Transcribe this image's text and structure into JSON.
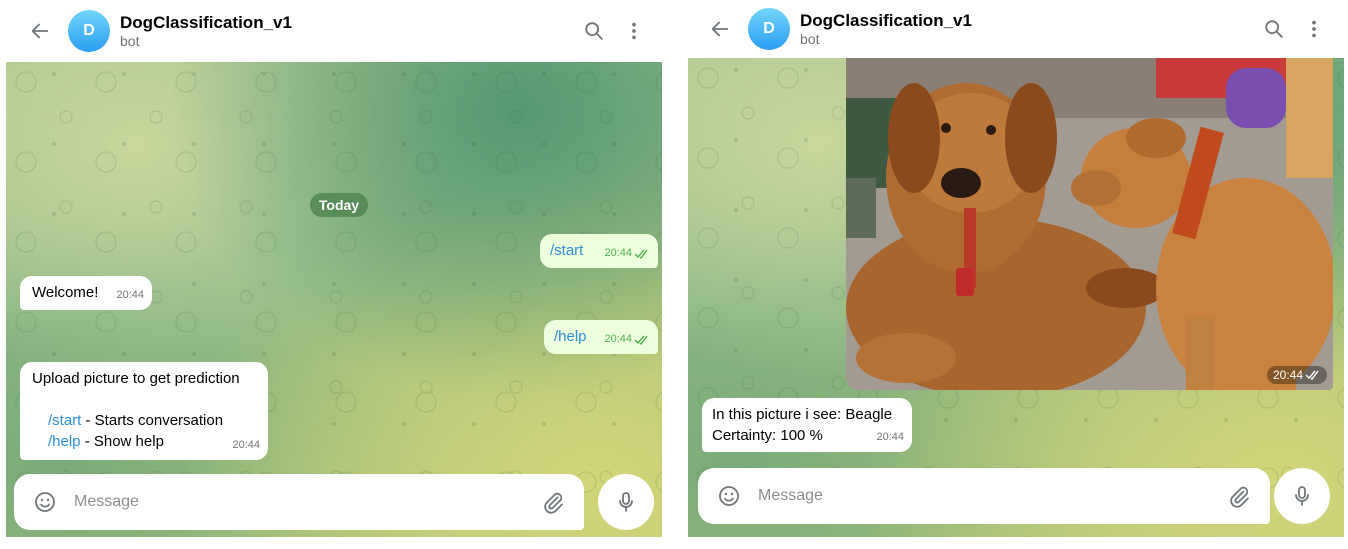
{
  "chat": {
    "title": "DogClassification_v1",
    "subtitle": "bot"
  },
  "icons": {
    "back": "arrow-left-icon",
    "search": "search-icon",
    "more": "more-vertical-icon",
    "emoji": "smile-icon",
    "attach": "paperclip-icon",
    "mic": "microphone-icon",
    "read": "double-check-icon"
  },
  "colors": {
    "outgoing_bubble": "#eeffde",
    "incoming_bubble": "#ffffff",
    "command_link": "#2e8fd8",
    "read_check": "#4fae4e",
    "avatar": "#2a9ef1"
  },
  "left_panel": {
    "avatar_letter": "D",
    "date_label": "Today",
    "messages": [
      {
        "direction": "out",
        "text": "/start",
        "time": "20:44"
      },
      {
        "direction": "in",
        "text": "Welcome!",
        "time": "20:44"
      },
      {
        "direction": "out",
        "text": "/help",
        "time": "20:44"
      },
      {
        "direction": "in",
        "intro": "Upload picture to get prediction",
        "lines": [
          {
            "cmd": "/start",
            "desc": " - Starts conversation"
          },
          {
            "cmd": "/help",
            "desc": " - Show help"
          }
        ],
        "time": "20:44"
      }
    ],
    "composer_placeholder": "Message"
  },
  "right_panel": {
    "avatar_letter": "D",
    "photo": {
      "alt": "Two brown dogs, one nuzzling the other's head",
      "time": "20:44"
    },
    "messages": [
      {
        "direction": "in",
        "line1": "In this picture i see: Beagle",
        "line2": "Certainty: 100 %",
        "time": "20:44"
      }
    ],
    "composer_placeholder": "Message"
  }
}
